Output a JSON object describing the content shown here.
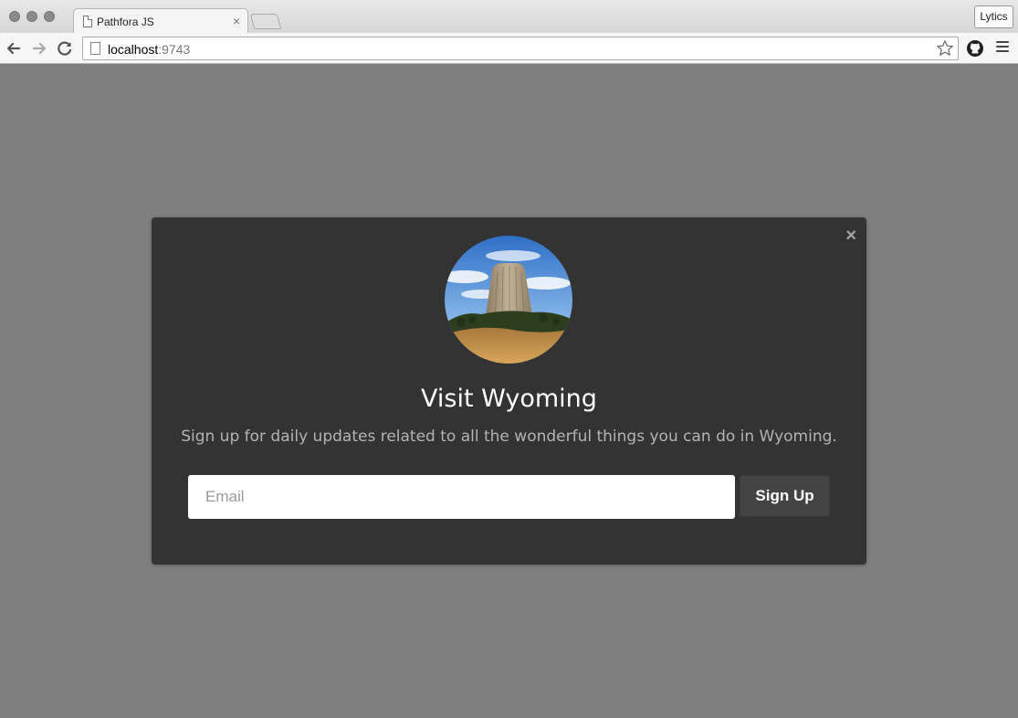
{
  "browser": {
    "tab_title": "Pathfora JS",
    "tab_close": "×",
    "profile_label": "Lytics",
    "url_host": "localhost",
    "url_port": ":9743"
  },
  "modal": {
    "close_glyph": "×",
    "headline": "Visit Wyoming",
    "message": "Sign up for daily updates related to all the wonderful things you can do in Wyoming.",
    "email_placeholder": "Email",
    "email_value": "",
    "button_label": "Sign Up",
    "colors": {
      "page_overlay": "#7f7f7f",
      "modal_bg": "#333333",
      "headline": "#ffffff",
      "message": "#b3b3b3",
      "button_bg": "#444444"
    }
  },
  "icons": [
    "back-arrow-icon",
    "forward-arrow-icon",
    "reload-icon",
    "page-icon",
    "star-icon",
    "github-icon",
    "menu-icon",
    "close-icon"
  ]
}
